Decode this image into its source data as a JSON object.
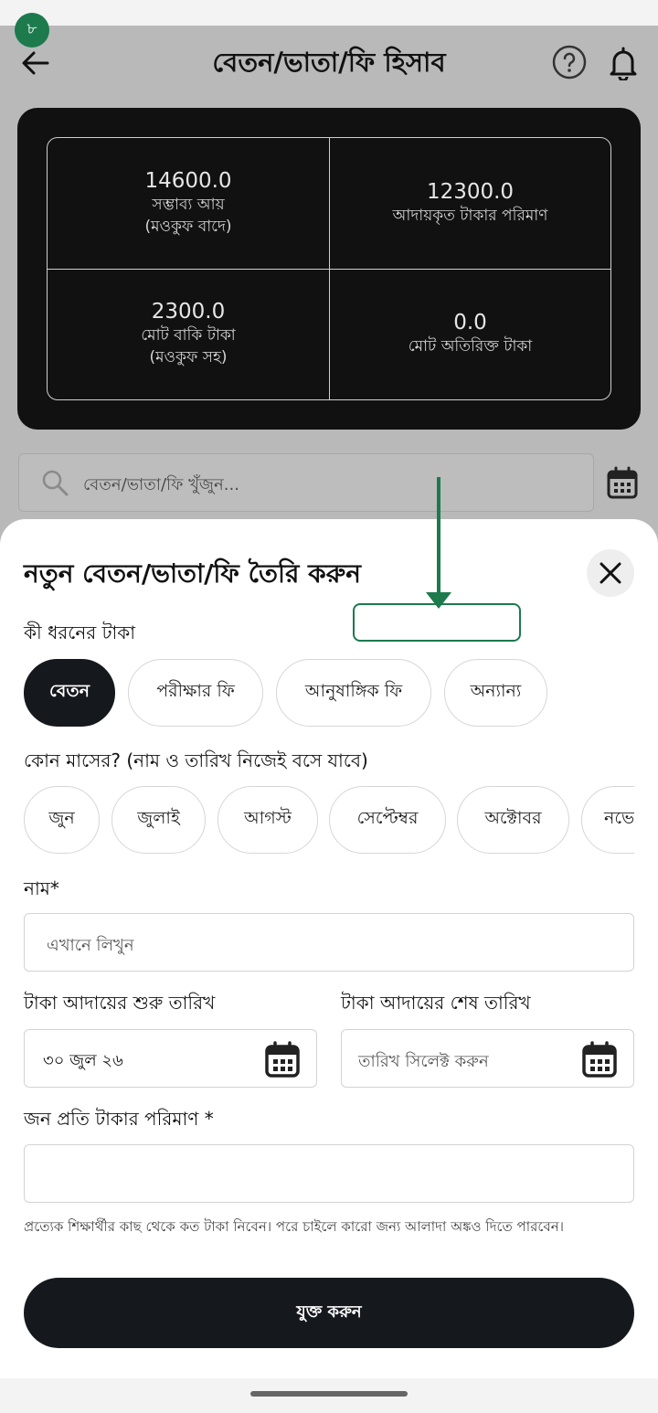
{
  "step_badge": "৮",
  "header": {
    "title": "বেতন/ভাতা/ফি হিসাব"
  },
  "summary": {
    "cells": [
      {
        "value": "14600.0",
        "label": "সম্ভাব্য আয়",
        "sub": "(মওকুফ বাদে)"
      },
      {
        "value": "12300.0",
        "label": "আদায়কৃত টাকার পরিমাণ",
        "sub": ""
      },
      {
        "value": "2300.0",
        "label": "মোট বাকি টাকা",
        "sub": "(মওকুফ সহ)"
      },
      {
        "value": "0.0",
        "label": "মোট অতিরিক্ত টাকা",
        "sub": ""
      }
    ]
  },
  "search": {
    "placeholder": "বেতন/ভাতা/ফি খুঁজুন..."
  },
  "sheet": {
    "title": "নতুন বেতন/ভাতা/ফি তৈরি করুন",
    "type_label": "কী ধরনের টাকা",
    "types": [
      "বেতন",
      "পরীক্ষার ফি",
      "আনুষাঙ্গিক ফি",
      "অন্যান্য"
    ],
    "selected_type": "বেতন",
    "month_label": "কোন মাসের? (নাম ও তারিখ নিজেই বসে যাবে)",
    "months": [
      "জুন",
      "জুলাই",
      "আগস্ট",
      "সেপ্টেম্বর",
      "অক্টোবর",
      "নভে"
    ],
    "name_label": "নাম*",
    "name_placeholder": "এখানে লিখুন",
    "start_date_label": "টাকা আদায়ের শুরু তারিখ",
    "start_date_value": "৩০ জুল ২৬",
    "end_date_label": "টাকা আদায়ের শেষ তারিখ",
    "end_date_placeholder": "তারিখ সিলেক্ট করুন",
    "amount_label": "জন প্রতি টাকার পরিমাণ *",
    "amount_value": "",
    "hint": "প্রত্যেক শিক্ষার্থীর কাছ থেকে কত টাকা নিবেন। পরে চাইলে কারো জন্য আলাদা অঙ্কও দিতে পারবেন।",
    "submit_label": "যুক্ত করুন"
  },
  "icons": {
    "back": "back-arrow-icon",
    "help": "help-icon",
    "bell": "bell-icon",
    "search": "search-icon",
    "calendar": "calendar-icon",
    "close": "close-icon"
  },
  "colors": {
    "accent": "#1c7a4d",
    "dark": "#15181c",
    "card": "#111111",
    "dim": "#b9b9b9"
  }
}
